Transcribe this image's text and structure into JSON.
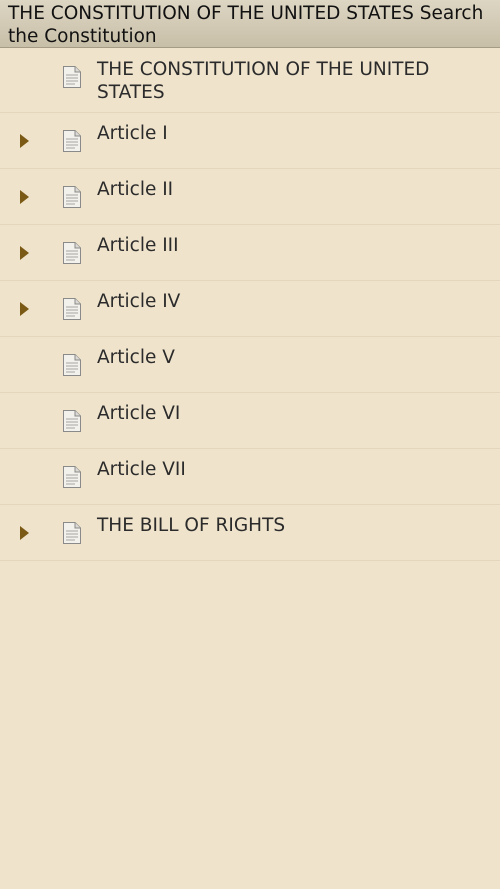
{
  "header": {
    "title": "THE CONSTITUTION OF THE UNITED STATES Search the Constitution"
  },
  "icons": {
    "expander": "triangle-right-icon",
    "document": "document-icon"
  },
  "colors": {
    "background": "#efe3cc",
    "expander": "#7a5a14"
  },
  "items": [
    {
      "label": "THE CONSTITUTION OF THE UNITED STATES",
      "expandable": false
    },
    {
      "label": "Article I",
      "expandable": true
    },
    {
      "label": "Article II",
      "expandable": true
    },
    {
      "label": "Article III",
      "expandable": true
    },
    {
      "label": "Article IV",
      "expandable": true
    },
    {
      "label": "Article V",
      "expandable": false
    },
    {
      "label": "Article VI",
      "expandable": false
    },
    {
      "label": "Article VII",
      "expandable": false
    },
    {
      "label": "THE BILL OF RIGHTS",
      "expandable": true
    }
  ]
}
